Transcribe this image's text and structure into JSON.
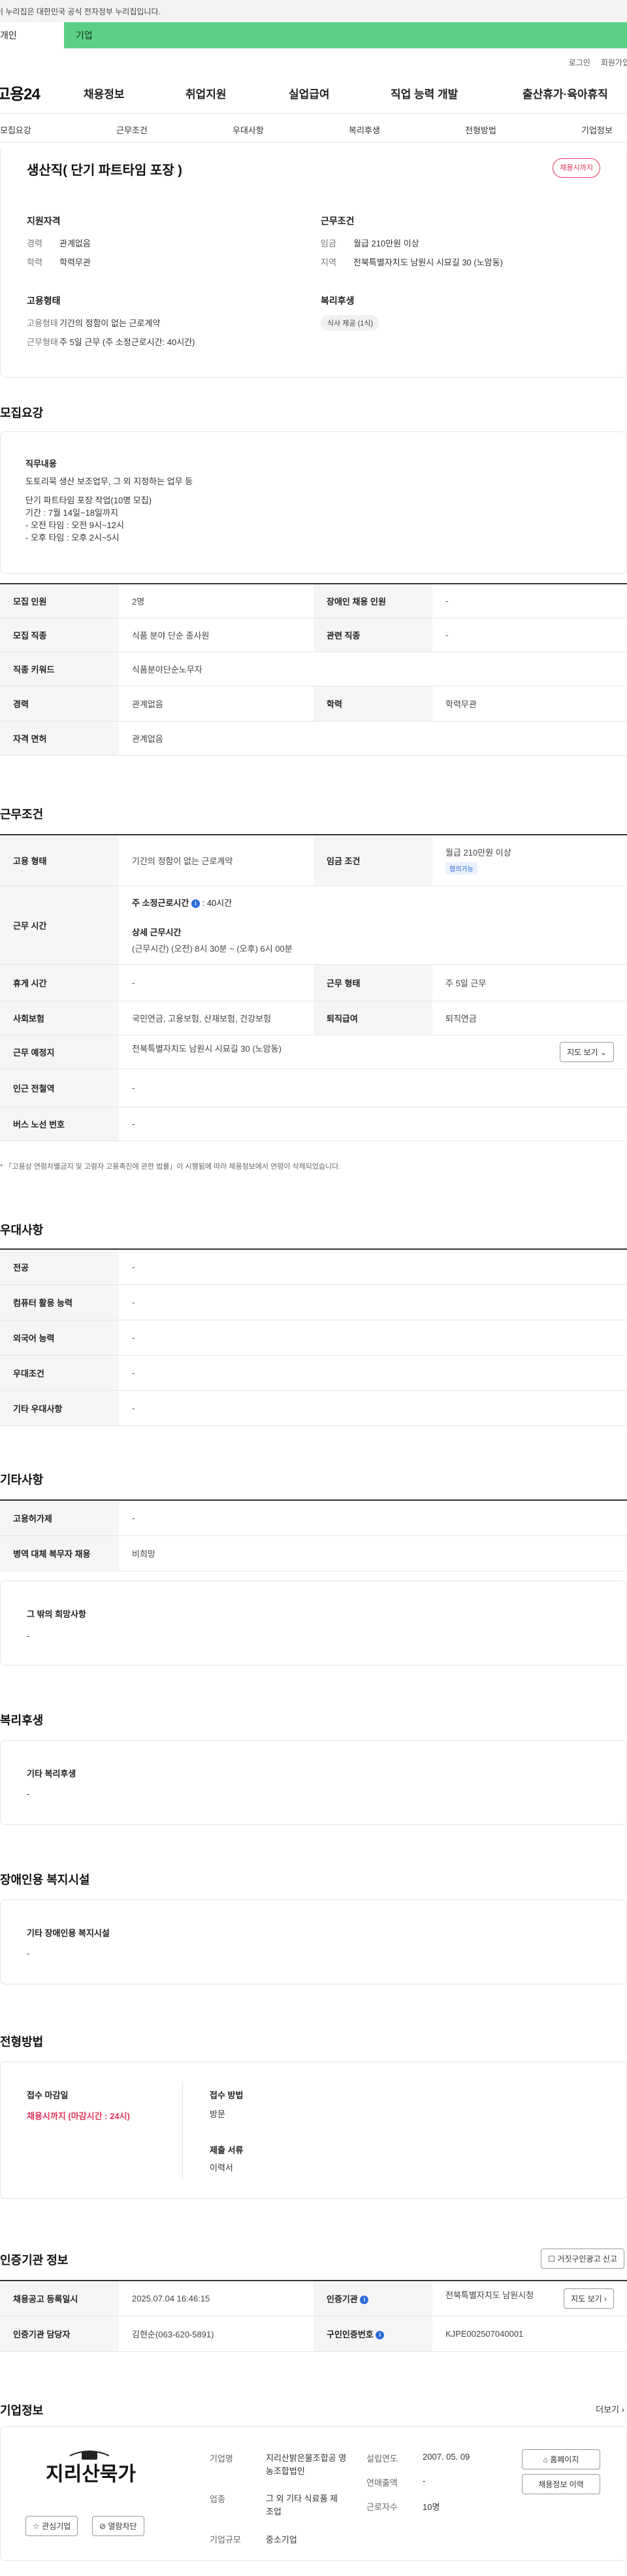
{
  "gov_banner": "이 누리집은 대한민국 공식 전자정부 누리집입니다.",
  "user_tabs": {
    "personal": "개인",
    "corp": "기업"
  },
  "util": {
    "login": "로그인",
    "signup": "회원가입"
  },
  "logo": "고용24",
  "gnb": [
    "채용정보",
    "취업지원",
    "실업급여",
    "직업 능력 개발",
    "출산휴가·육아휴직"
  ],
  "tabs": [
    "모집요강",
    "근무조건",
    "우대사항",
    "복리후생",
    "전형방법",
    "기업정보"
  ],
  "job": {
    "title": "생산직( 단기 파트타임 포장 )",
    "status": "채용시까지",
    "qual": {
      "heading": "지원자격",
      "career_k": "경력",
      "career_v": "관계없음",
      "edu_k": "학력",
      "edu_v": "학력무관"
    },
    "cond": {
      "heading": "근무조건",
      "wage_k": "임금",
      "wage_v": "월급 210만원 이상",
      "loc_k": "지역",
      "loc_v": "전북특별자치도 남원시 시묘길 30 (노암동)"
    },
    "emp": {
      "heading": "고용형태",
      "type_k": "고용형태",
      "type_v": "기간의 정함이 없는 근로계약",
      "time_k": "근무형태",
      "time_v": "주 5일 근무 (주 소정근로시간: 40시간)"
    },
    "welfare": {
      "heading": "복리후생",
      "chip": "식사 제공 (1식)"
    }
  },
  "recruit": {
    "title": "모집요강",
    "duty_heading": "직무내용",
    "duty_lines": [
      "도토리묵 생산 보조업무, 그 외 지정하는 업무 등",
      "",
      "단기 파트타임 포장 작업(10명 모집)",
      "기간 : 7월 14일~18일까지",
      " - 오전 타임 : 오전 9시~12시",
      " - 오후 타임 : 오후 2시~5시"
    ],
    "rows": [
      {
        "k1": "모집 인원",
        "v1": "2명",
        "k2": "장애인 채용 인원",
        "v2": "-"
      },
      {
        "k1": "모집 직종",
        "v1": "식품 분야 단순 종사원",
        "k2": "관련 직종",
        "v2": "-"
      },
      {
        "k1": "직종 키워드",
        "v1": "식품분야단순노무자"
      },
      {
        "k1": "경력",
        "v1": "관계없음",
        "k2": "학력",
        "v2": "학력무관"
      },
      {
        "k1": "자격 면허",
        "v1": "관계없음"
      }
    ]
  },
  "work": {
    "title": "근무조건",
    "type_k": "고용 형태",
    "type_v": "기간의 정함이 없는 근로계약",
    "wage_k": "임금 조건",
    "wage_v": "월급 210만원 이상",
    "wage_badge": "협의가능",
    "hours_k": "근무 시간",
    "hours_weekly_label": "주 소정근로시간",
    "hours_weekly": ": 40시간",
    "hours_detail_h": "상세 근무시간",
    "hours_detail": "(근무시간) (오전) 8시 30분 ~ (오후) 6시 00분",
    "rest_k": "휴게 시간",
    "rest_v": "-",
    "form_k": "근무 형태",
    "form_v": "주 5일 근무",
    "ins_k": "사회보험",
    "ins_v": "국민연금, 고용보험, 산재보험, 건강보험",
    "ret_k": "퇴직급여",
    "ret_v": "퇴직연금",
    "place_k": "근무 예정지",
    "place_v": "전북특별자치도 남원시 시묘길 30 (노암동)",
    "map_btn": "지도 보기",
    "subway_k": "인근 전철역",
    "subway_v": "-",
    "bus_k": "버스 노선 번호",
    "bus_v": "-",
    "note": "* 「고용상 연령차별금지 및 고령자 고용촉진에 관한 법률」이 시행됨에 따라 채용정보에서 연령이 삭제되었습니다."
  },
  "pref": {
    "title": "우대사항",
    "rows": [
      {
        "k": "전공",
        "v": "-"
      },
      {
        "k": "컴퓨터 활용 능력",
        "v": "-"
      },
      {
        "k": "외국어 능력",
        "v": "-"
      },
      {
        "k": "우대조건",
        "v": "-"
      },
      {
        "k": "기타 우대사항",
        "v": "-"
      }
    ]
  },
  "etc": {
    "title": "기타사항",
    "rows": [
      {
        "k": "고용허가제",
        "v": "-"
      },
      {
        "k": "병역 대체 복무자 채용",
        "v": "비희망"
      }
    ],
    "other_h": "그 밖의 희망사항",
    "other_v": "-"
  },
  "welfare": {
    "title": "복리후생",
    "h": "기타 복리후생",
    "v": "-"
  },
  "facility": {
    "title": "장애인용 복지시설",
    "h": "기타 장애인용 복지시설",
    "v": "-"
  },
  "selection": {
    "title": "전형방법",
    "deadline_h": "접수 마감일",
    "deadline_v": "채용시까지 (마감시간 : 24시)",
    "method_h": "접수 방법",
    "method_v": "방문",
    "docs_h": "제출 서류",
    "docs_v": "이력서"
  },
  "auth": {
    "title": "인증기관 정보",
    "report_btn": "거짓구인광고 신고",
    "reg_k": "채용공고 등록일시",
    "reg_v": "2025.07.04 16:46:15",
    "org_k": "인증기관",
    "org_v": "전북특별자치도 남원시청",
    "map_btn": "지도 보기",
    "mgr_k": "인증기관 담당자",
    "mgr_v": "김현순(063-620-5891)",
    "no_k": "구인인증번호",
    "no_v": "KJPE002507040001"
  },
  "company": {
    "title": "기업정보",
    "more": "더보기",
    "logo_text": "지리산묵가",
    "fav_btn": "관심기업",
    "block_btn": "열람차단",
    "name_k": "기업명",
    "name_v": "지리산밝은물조합공 영농조합법인",
    "industry_k": "업종",
    "industry_v": "그 외 기타 식료품 제조업",
    "scale_k": "기업규모",
    "scale_v": "중소기업",
    "year_k": "설립연도",
    "year_v": "2007. 05. 09",
    "sales_k": "연매출액",
    "sales_v": "-",
    "staff_k": "근로자수",
    "staff_v": "10명",
    "home_btn": "홈페이지",
    "history_btn": "채용정보 이력"
  }
}
